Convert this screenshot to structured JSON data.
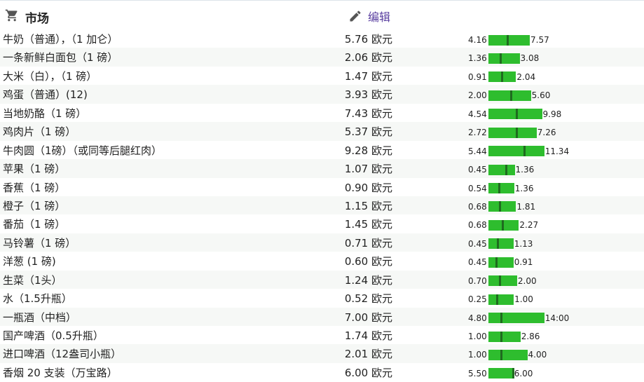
{
  "header": {
    "title": "市场",
    "edit_label": "编辑",
    "cart_icon": "cart-icon",
    "edit_icon": "pencil-icon"
  },
  "colors": {
    "bar": "#2ebd2e",
    "marker": "#1f6b1f",
    "link": "#5a3fa0",
    "stripe": "#f6f8f6"
  },
  "items": [
    {
      "name": "牛奶（普通），（1 加仑）",
      "price": "5.76 欧元",
      "low": "4.16",
      "high": "7.57"
    },
    {
      "name": "一条新鲜白面包（1 磅）",
      "price": "2.06 欧元",
      "low": "1.36",
      "high": "3.08"
    },
    {
      "name": "大米（白），（1 磅）",
      "price": "1.47 欧元",
      "low": "0.91",
      "high": "2.04"
    },
    {
      "name": "鸡蛋（普通）(12)",
      "price": "3.93 欧元",
      "low": "2.00",
      "high": "5.60"
    },
    {
      "name": "当地奶酪（1 磅）",
      "price": "7.43 欧元",
      "low": "4.54",
      "high": "9.98"
    },
    {
      "name": "鸡肉片（1 磅）",
      "price": "5.37 欧元",
      "low": "2.72",
      "high": "7.26"
    },
    {
      "name": "牛肉圆（1磅）（或同等后腿红肉）",
      "price": "9.28 欧元",
      "low": "5.44",
      "high": "11.34"
    },
    {
      "name": "苹果（1 磅）",
      "price": "1.07 欧元",
      "low": "0.45",
      "high": "1.36"
    },
    {
      "name": "香蕉（1 磅）",
      "price": "0.90 欧元",
      "low": "0.54",
      "high": "1.36"
    },
    {
      "name": "橙子（1 磅）",
      "price": "1.15 欧元",
      "low": "0.68",
      "high": "1.81"
    },
    {
      "name": "番茄（1 磅）",
      "price": "1.45 欧元",
      "low": "0.68",
      "high": "2.27"
    },
    {
      "name": "马铃薯（1 磅）",
      "price": "0.71 欧元",
      "low": "0.45",
      "high": "1.13"
    },
    {
      "name": "洋葱 (1 磅)",
      "price": "0.60 欧元",
      "low": "0.45",
      "high": "0.91"
    },
    {
      "name": "生菜（1头）",
      "price": "1.24 欧元",
      "low": "0.70",
      "high": "2.00"
    },
    {
      "name": "水（1.5升瓶）",
      "price": "0.52 欧元",
      "low": "0.25",
      "high": "1.00"
    },
    {
      "name": "一瓶酒（中档）",
      "price": "7.00 欧元",
      "low": "4.80",
      "high": "14:00"
    },
    {
      "name": "国产啤酒（0.5升瓶）",
      "price": "1.74 欧元",
      "low": "1.00",
      "high": "2.86"
    },
    {
      "name": "进口啤酒（12盎司小瓶）",
      "price": "2.01 欧元",
      "low": "1.00",
      "high": "4.00"
    },
    {
      "name": "香烟 20 支装（万宝路）",
      "price": "6.00 欧元",
      "low": "5.50",
      "high": "6.00"
    }
  ]
}
